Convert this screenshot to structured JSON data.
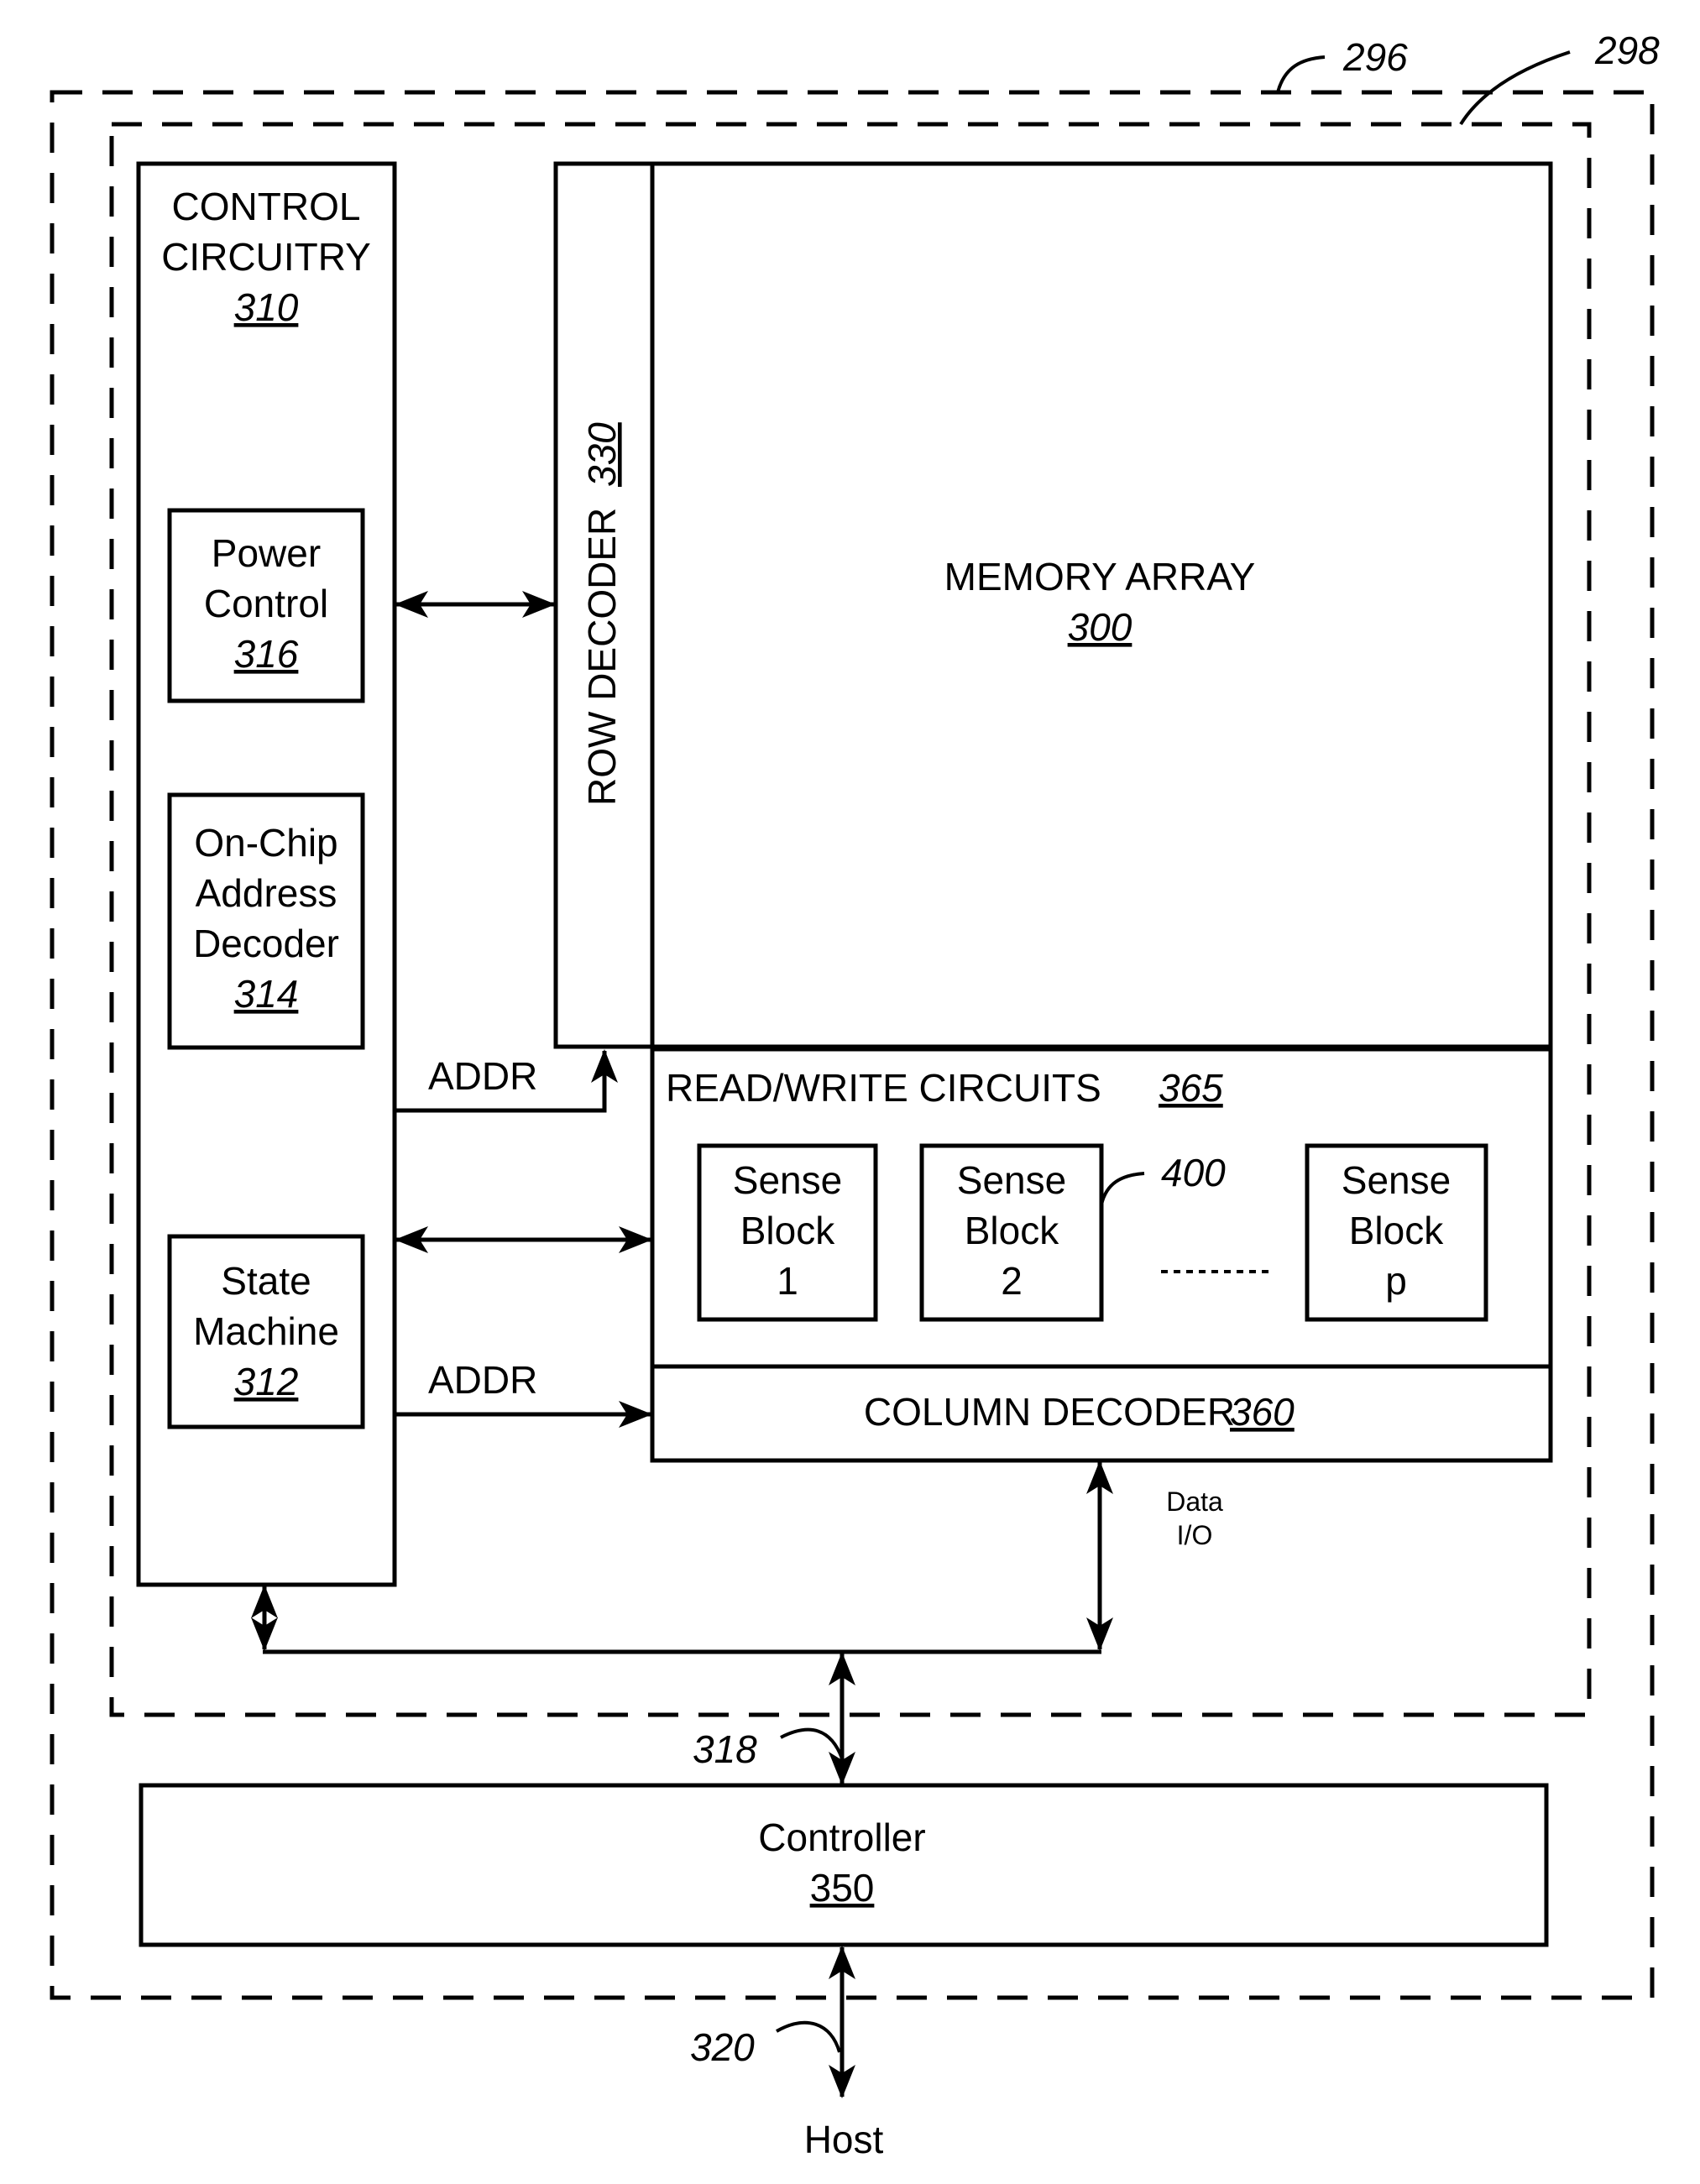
{
  "figure": {
    "callouts": {
      "outer_boundary": "296",
      "inner_boundary": "298",
      "bus_318": "318",
      "host_link": "320",
      "sense_block_ref": "400"
    },
    "control_circuitry": {
      "title_line1": "CONTROL",
      "title_line2": "CIRCUITRY",
      "ref": "310",
      "power_control": {
        "line1": "Power",
        "line2": "Control",
        "ref": "316"
      },
      "address_decoder": {
        "line1": "On-Chip",
        "line2": "Address",
        "line3": "Decoder",
        "ref": "314"
      },
      "state_machine": {
        "line1": "State",
        "line2": "Machine",
        "ref": "312"
      }
    },
    "row_decoder": {
      "label": "ROW DECODER",
      "ref": "330"
    },
    "memory_array": {
      "label": "MEMORY ARRAY",
      "ref": "300"
    },
    "read_write": {
      "label": "READ/WRITE CIRCUITS",
      "ref": "365",
      "sense_blocks": [
        {
          "line1": "Sense",
          "line2": "Block",
          "line3": "1"
        },
        {
          "line1": "Sense",
          "line2": "Block",
          "line3": "2"
        },
        {
          "line1": "Sense",
          "line2": "Block",
          "line3": "p"
        }
      ],
      "ellipsis": "---------"
    },
    "column_decoder": {
      "label": "COLUMN DECODER",
      "ref": "360"
    },
    "signals": {
      "addr_upper": "ADDR",
      "addr_lower": "ADDR",
      "data_io_line1": "Data",
      "data_io_line2": "I/O"
    },
    "controller": {
      "label": "Controller",
      "ref": "350"
    },
    "host": {
      "label": "Host"
    }
  }
}
